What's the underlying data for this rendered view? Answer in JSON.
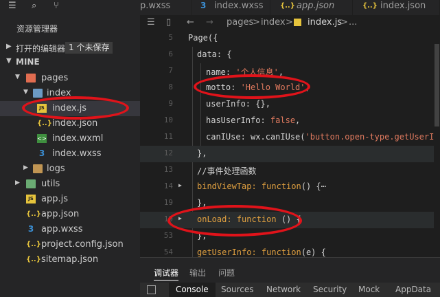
{
  "sidebar": {
    "explorer_title": "资源管理器",
    "open_editors_label": "打开的编辑器",
    "open_editors_badge": "1 个未保存",
    "project_label": "MINE",
    "tree": [
      {
        "name": "pages",
        "icon": "folder-icon"
      },
      {
        "name": "index",
        "icon": "folder-icon"
      },
      {
        "name": "index.js",
        "icon": "js-file-icon"
      },
      {
        "name": "index.json",
        "icon": "json-file-icon"
      },
      {
        "name": "index.wxml",
        "icon": "wxml-file-icon"
      },
      {
        "name": "index.wxss",
        "icon": "wxss-file-icon"
      },
      {
        "name": "logs",
        "icon": "folder-icon"
      },
      {
        "name": "utils",
        "icon": "folder-icon"
      },
      {
        "name": "app.js",
        "icon": "js-file-icon"
      },
      {
        "name": "app.json",
        "icon": "json-file-icon"
      },
      {
        "name": "app.wxss",
        "icon": "wxss-file-icon"
      },
      {
        "name": "project.config.json",
        "icon": "json-file-icon"
      },
      {
        "name": "sitemap.json",
        "icon": "json-file-icon"
      }
    ]
  },
  "tabs": [
    {
      "label": "p.wxss",
      "icon": "wxss-file-icon"
    },
    {
      "label": "index.wxss",
      "icon": "wxss-file-icon"
    },
    {
      "label": "app.json",
      "icon": "json-file-icon"
    },
    {
      "label": "index.json",
      "icon": "json-file-icon"
    }
  ],
  "breadcrumb": {
    "parts": [
      "pages",
      "index",
      "index.js",
      "..."
    ],
    "separator": ">"
  },
  "editor": {
    "lines": [
      {
        "num": "5",
        "text": "Page({"
      },
      {
        "num": "6",
        "text": "data: {"
      },
      {
        "num": "7",
        "prop": "name: ",
        "value": "'个人信息'",
        "tail": ","
      },
      {
        "num": "8",
        "prop": "motto: ",
        "value": "'Hello World'",
        "tail": ","
      },
      {
        "num": "9",
        "text": "userInfo: {},"
      },
      {
        "num": "10",
        "prop": "hasUserInfo: ",
        "value": "false",
        "tail": ","
      },
      {
        "num": "11",
        "prop": "canIUse: wx.canIUse(",
        "value": "'button.open-type.getUserInfo'",
        "tail": ")"
      },
      {
        "num": "12",
        "text": "},"
      },
      {
        "num": "13",
        "text": "//事件处理函数"
      },
      {
        "num": "14",
        "prop": "bindViewTap: ",
        "value": "function",
        "tail": "() {⋯"
      },
      {
        "num": "19",
        "text": "},"
      },
      {
        "num": "19",
        "prop": "onLoad: ",
        "value": "function",
        "tail": " () {"
      },
      {
        "num": "53",
        "text": "},"
      },
      {
        "num": "54",
        "prop": "getUserInfo: ",
        "value": "function",
        "tail": "(e) {"
      }
    ]
  },
  "panel": {
    "tabs": [
      "调试器",
      "输出",
      "问题"
    ],
    "devtools": [
      "Console",
      "Sources",
      "Network",
      "Security",
      "Mock",
      "AppData"
    ]
  },
  "colors": {
    "annotation": "#e0131a",
    "keyword": "#e0a040",
    "string": "#e07a5f",
    "comment": "#6a9955"
  }
}
